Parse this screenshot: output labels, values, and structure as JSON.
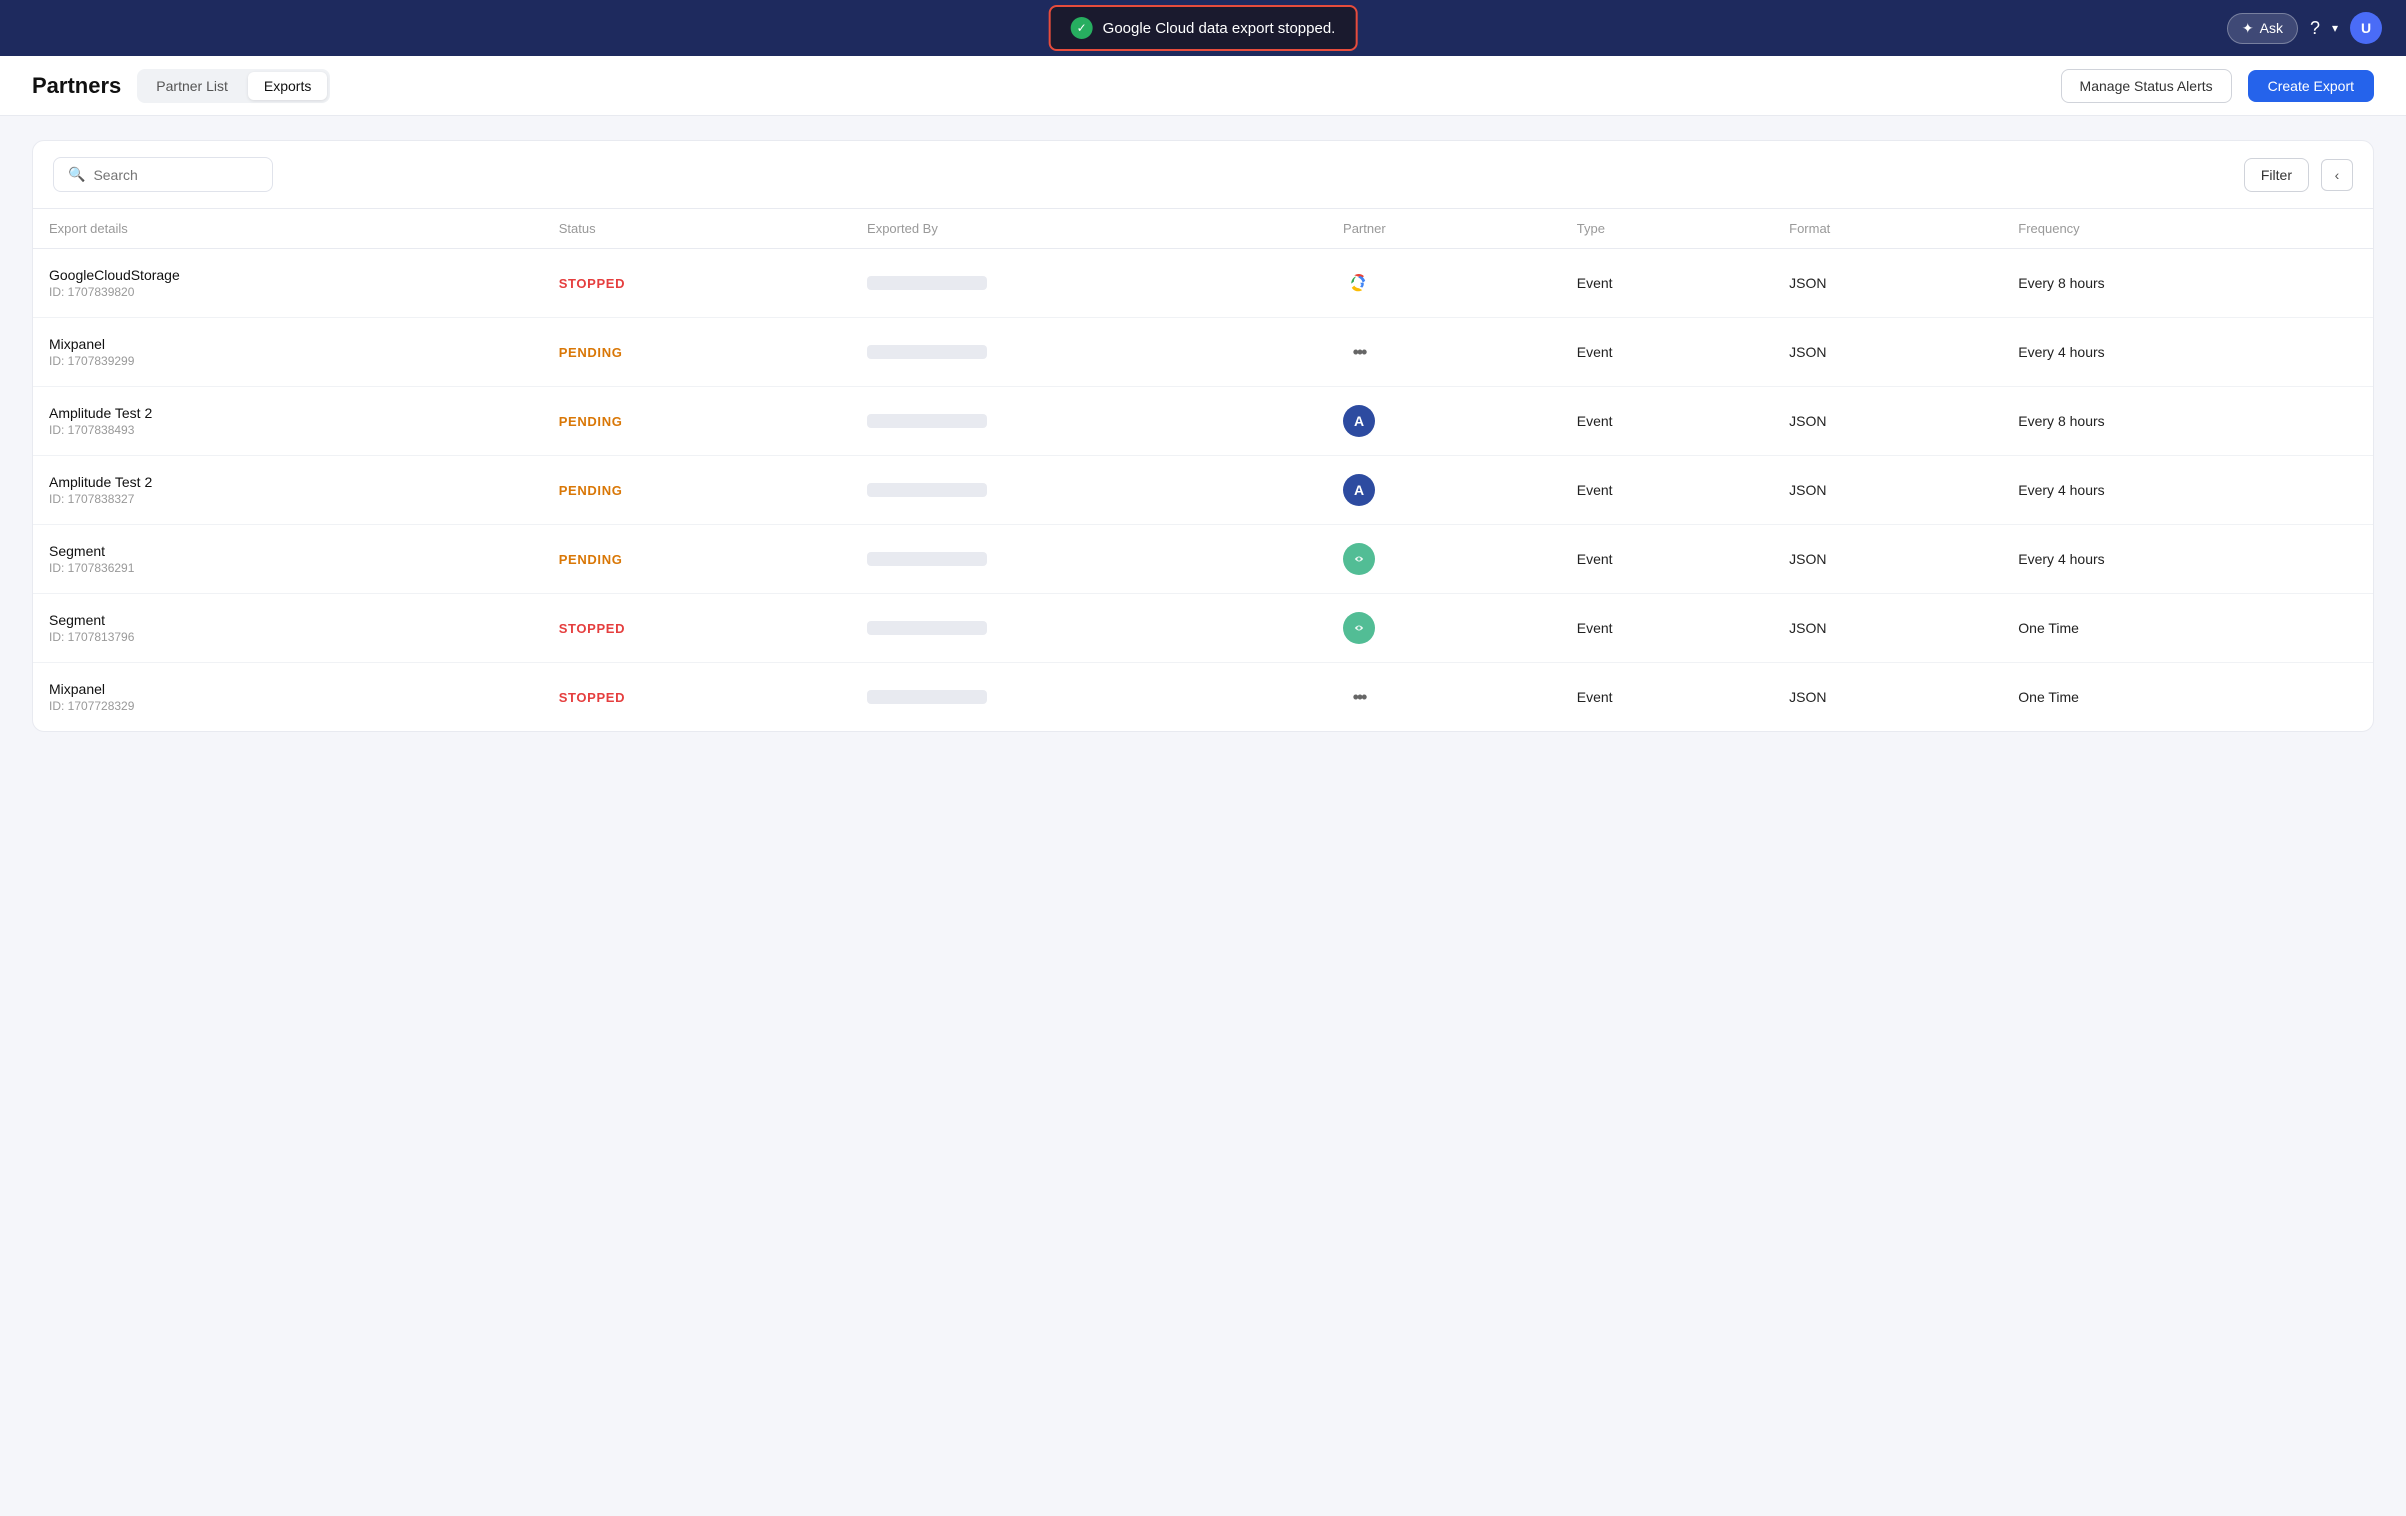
{
  "nav": {
    "ask_label": "Ask",
    "user_initial": "U"
  },
  "toast": {
    "message": "Google Cloud data export stopped.",
    "icon": "✓"
  },
  "header": {
    "title": "Partners",
    "tabs": [
      {
        "label": "Partner List",
        "active": false
      },
      {
        "label": "Exports",
        "active": true
      }
    ],
    "manage_alerts_label": "Manage Status Alerts",
    "create_export_label": "Create Export"
  },
  "toolbar": {
    "search_placeholder": "Search",
    "filter_label": "Filter",
    "collapse_icon": "‹"
  },
  "table": {
    "columns": [
      "Export details",
      "Status",
      "Exported By",
      "Partner",
      "Type",
      "Format",
      "Frequency"
    ],
    "rows": [
      {
        "name": "GoogleCloudStorage",
        "id": "ID: 1707839820",
        "status": "STOPPED",
        "status_type": "stopped",
        "partner_type": "gcs",
        "type": "Event",
        "format": "JSON",
        "frequency": "Every 8 hours"
      },
      {
        "name": "Mixpanel",
        "id": "ID: 1707839299",
        "status": "PENDING",
        "status_type": "pending",
        "partner_type": "mixpanel",
        "type": "Event",
        "format": "JSON",
        "frequency": "Every 4 hours"
      },
      {
        "name": "Amplitude Test 2",
        "id": "ID: 1707838493",
        "status": "PENDING",
        "status_type": "pending",
        "partner_type": "amplitude",
        "type": "Event",
        "format": "JSON",
        "frequency": "Every 8 hours"
      },
      {
        "name": "Amplitude Test 2",
        "id": "ID: 1707838327",
        "status": "PENDING",
        "status_type": "pending",
        "partner_type": "amplitude",
        "type": "Event",
        "format": "JSON",
        "frequency": "Every 4 hours"
      },
      {
        "name": "Segment",
        "id": "ID: 1707836291",
        "status": "PENDING",
        "status_type": "pending",
        "partner_type": "segment",
        "type": "Event",
        "format": "JSON",
        "frequency": "Every 4 hours"
      },
      {
        "name": "Segment",
        "id": "ID: 1707813796",
        "status": "STOPPED",
        "status_type": "stopped",
        "partner_type": "segment",
        "type": "Event",
        "format": "JSON",
        "frequency": "One Time"
      },
      {
        "name": "Mixpanel",
        "id": "ID: 1707728329",
        "status": "STOPPED",
        "status_type": "stopped",
        "partner_type": "mixpanel",
        "type": "Event",
        "format": "JSON",
        "frequency": "One Time"
      }
    ]
  }
}
